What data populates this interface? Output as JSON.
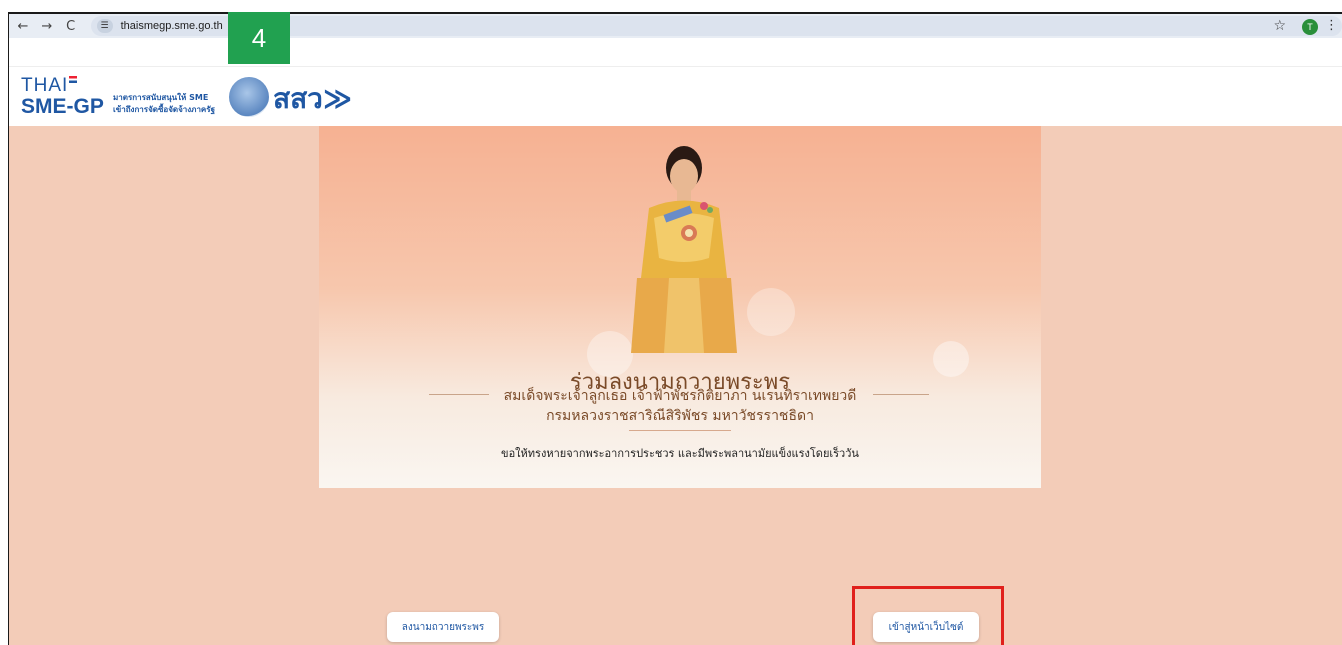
{
  "browser": {
    "top_glyph": "ู",
    "back_icon": "back-arrow-icon",
    "forward_icon": "forward-arrow-icon",
    "reload_icon": "reload-icon",
    "site_info_icon": "site-info-icon",
    "url": "thaismegp.sme.go.th",
    "profile_initial": "T"
  },
  "step_badge": "4",
  "header": {
    "logo_thai": "THAI",
    "logo_smegp": "SME-GP",
    "tagline_line1": "มาตรการสนับสนุนให้ SME",
    "tagline_line2": "เข้าถึงการจัดซื้อจัดจ้างภาครัฐ",
    "logo_osmep": "สสว",
    "brand_color": "#1f57a3"
  },
  "banner": {
    "title": "ร่วมลงนามถวายพระพร",
    "subtitle_line1": "สมเด็จพระเจ้าลูกเธอ เจ้าฟ้าพัชรกิติยาภา นเรนทิราเทพยวดี",
    "subtitle_line2": "กรมหลวงราชสาริณีสิริพัชร มหาวัชรราชธิดา",
    "wish": "ขอให้ทรงหายจากพระอาการประชวร และมีพระพลานามัยแข็งแรงโดยเร็ววัน"
  },
  "buttons": {
    "sign": "ลงนามถวายพระพร",
    "enter_site": "เข้าสู่หน้าเว็บไซต์"
  },
  "colors": {
    "page_bg": "#f3ccb8",
    "highlight": "#e0201c",
    "badge": "#21a150"
  }
}
